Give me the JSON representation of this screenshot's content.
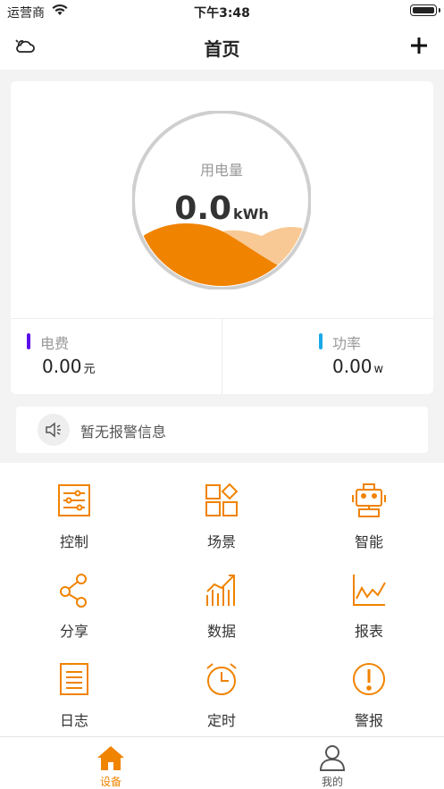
{
  "status_bar": {
    "carrier": "运营商",
    "time": "下午3:48"
  },
  "navbar": {
    "title": "首页",
    "left_icon": "weather-cloud-icon",
    "right_icon": "plus-icon"
  },
  "energy": {
    "label": "用电量",
    "value": "0.0",
    "unit": "kWh",
    "accent_color": "#f08300",
    "wave_light_color": "#f8c995"
  },
  "stats": [
    {
      "label": "电费",
      "value": "0.00",
      "unit": "元",
      "color": "#5b0ee8"
    },
    {
      "label": "功率",
      "value": "0.00",
      "unit": "w",
      "color": "#1aa9e8"
    }
  ],
  "alarm": {
    "text": "暂无报警信息",
    "icon": "speaker-icon"
  },
  "menu": [
    {
      "label": "控制",
      "icon": "sliders-icon"
    },
    {
      "label": "场景",
      "icon": "scene-grid-icon"
    },
    {
      "label": "智能",
      "icon": "robot-icon"
    },
    {
      "label": "分享",
      "icon": "share-icon"
    },
    {
      "label": "数据",
      "icon": "bar-chart-icon"
    },
    {
      "label": "报表",
      "icon": "line-chart-icon"
    },
    {
      "label": "日志",
      "icon": "log-document-icon"
    },
    {
      "label": "定时",
      "icon": "alarm-clock-icon"
    },
    {
      "label": "警报",
      "icon": "alert-icon"
    }
  ],
  "tabbar": [
    {
      "label": "设备",
      "icon": "home-icon",
      "active": true,
      "color": "#f08300"
    },
    {
      "label": "我的",
      "icon": "user-icon",
      "active": false,
      "color": "#555555"
    }
  ]
}
